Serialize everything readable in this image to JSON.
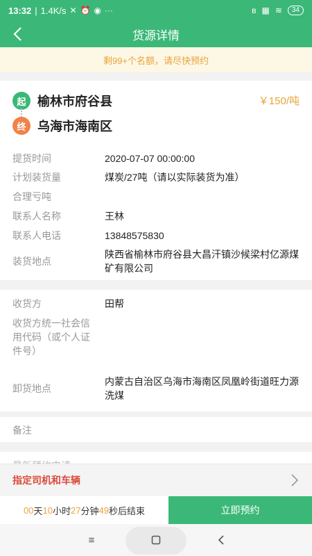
{
  "status_bar": {
    "time": "13:32",
    "speed": "1.4K/s",
    "battery": "34",
    "icons": [
      "mute-icon",
      "alarm-icon",
      "wechat-icon",
      "more-icon",
      "bluetooth-icon",
      "signal-icon",
      "wifi-icon",
      "battery-icon"
    ]
  },
  "header": {
    "title": "货源详情"
  },
  "notice": {
    "text": "剩99+个名额，请尽快预约"
  },
  "route": {
    "start_badge": "起",
    "start_city": "榆林市府谷县",
    "end_badge": "终",
    "end_city": "乌海市海南区",
    "price": "￥150/吨"
  },
  "details": [
    {
      "label": "提货时间",
      "value": "2020-07-07 00:00:00"
    },
    {
      "label": "计划装货量",
      "value": "煤炭/27吨（请以实际装货为准）"
    },
    {
      "label": "合理亏吨",
      "value": ""
    },
    {
      "label": "联系人名称",
      "value": "王林"
    },
    {
      "label": "联系人电话",
      "value": "13848575830"
    },
    {
      "label": "装货地点",
      "value": "陕西省榆林市府谷县大昌汗镇沙候梁村亿源煤矿有限公司"
    }
  ],
  "receiver": [
    {
      "label": "收货方",
      "value": "田帮"
    },
    {
      "label": "收货方统一社会信用代码（或个人证件号）",
      "value": ""
    },
    {
      "label": "卸货地点",
      "value": "内蒙古自治区乌海市海南区凤凰岭街道旺力源洗煤"
    }
  ],
  "remark": {
    "label": "备注",
    "value": ""
  },
  "peek_text": "最新预约申请",
  "assign": {
    "label": "指定司机和车辆"
  },
  "countdown": {
    "days": "00",
    "days_unit": "天",
    "hours": "10",
    "hours_unit": "小时",
    "minutes": "27",
    "minutes_unit": "分钟",
    "seconds": "49",
    "seconds_unit": "秒后结束"
  },
  "book_button": {
    "label": "立即预约"
  },
  "colors": {
    "primary": "#3bb878",
    "accent": "#e8a43a",
    "danger": "#d94b3b",
    "end_badge": "#f0824a"
  }
}
